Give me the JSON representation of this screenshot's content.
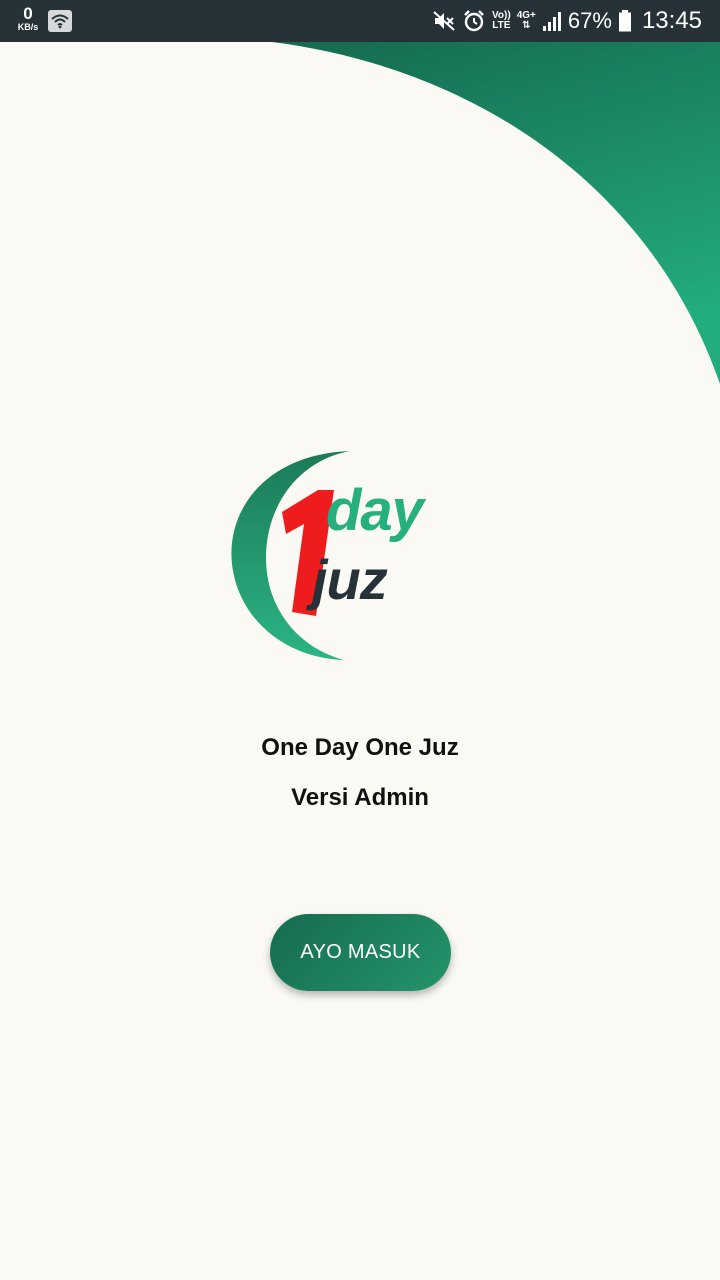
{
  "status_bar": {
    "net_speed_value": "0",
    "net_speed_unit": "KB/s",
    "volte_line1": "Vo))",
    "volte_line2": "LTE",
    "network_type": "4G+",
    "battery_percent": "67%",
    "time": "13:45",
    "icons": [
      "wifi-icon",
      "mute-icon",
      "alarm-icon",
      "signal-icon",
      "battery-icon"
    ]
  },
  "logo": {
    "numeral": "1",
    "word_top": "day",
    "word_bottom": "juz",
    "colors": {
      "numeral": "#ee1c1c",
      "arc": "#23a97a",
      "word_top": "#27b07f",
      "word_bottom": "#263238"
    }
  },
  "main": {
    "title": "One Day One Juz",
    "subtitle": "Versi Admin",
    "login_button_label": "AYO MASUK"
  },
  "theme": {
    "background": "#faf9f3",
    "status_bar": "#263238",
    "accent_dark": "#166b50",
    "accent_light": "#22aa7d"
  }
}
